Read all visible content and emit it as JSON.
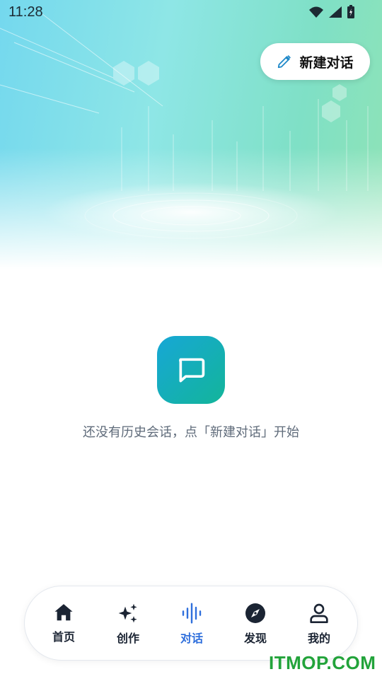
{
  "status_bar": {
    "time": "11:28"
  },
  "header": {
    "new_chat_label": "新建对话"
  },
  "empty_state": {
    "message": "还没有历史会话，点「新建对话」开始"
  },
  "tabs": [
    {
      "label": "首页",
      "icon": "home-icon",
      "active": false
    },
    {
      "label": "创作",
      "icon": "sparkle-icon",
      "active": false
    },
    {
      "label": "对话",
      "icon": "voice-wave-icon",
      "active": true
    },
    {
      "label": "发现",
      "icon": "compass-icon",
      "active": false
    },
    {
      "label": "我的",
      "icon": "person-icon",
      "active": false
    }
  ],
  "watermark": "ITMOP.COM",
  "colors": {
    "accent": "#2f6fdc",
    "icon_gradient_start": "#17a7d6",
    "icon_gradient_end": "#13b59a"
  }
}
